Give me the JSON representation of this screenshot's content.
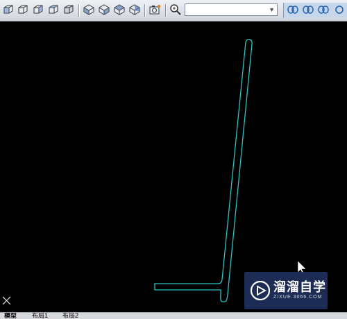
{
  "toolbar": {
    "view_buttons": [
      "top-view-icon",
      "front-view-icon",
      "left-view-icon",
      "right-view-icon",
      "back-view-icon"
    ],
    "iso_buttons": [
      "sw-iso-icon",
      "se-iso-icon",
      "ne-iso-icon",
      "nw-iso-icon"
    ],
    "camera_button": "named-views-icon",
    "zoom_button": "zoom-realtime-icon",
    "view_combo_value": "",
    "right_buttons": [
      "orbit-icon",
      "constrained-orbit-icon",
      "free-orbit-icon"
    ]
  },
  "canvas": {
    "background": "#000000",
    "drawing_color": "#2fc4c4",
    "ucs_icon": "ucs-x-icon",
    "cursor": "arrow-cursor-icon"
  },
  "layout_tabs": [
    "模型",
    "布局1",
    "布局2"
  ],
  "watermark": {
    "title": "溜溜自学",
    "subtitle": "ZIXUE.3066.COM",
    "icon": "play-logo-icon"
  }
}
